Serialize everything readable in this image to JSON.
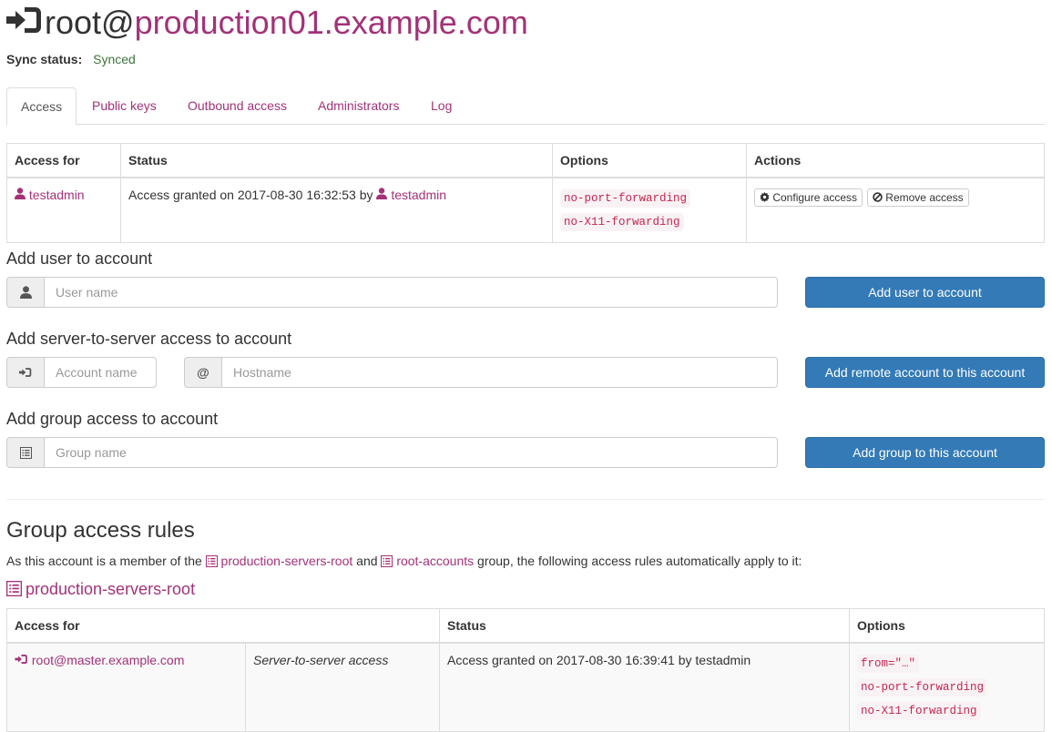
{
  "header": {
    "user": "root",
    "at": "@",
    "hostname": "production01.example.com",
    "sync_label": "Sync status:",
    "sync_value": "Synced",
    "sync_color": "#3c763d"
  },
  "tabs": [
    {
      "label": "Access",
      "active": true
    },
    {
      "label": "Public keys",
      "active": false
    },
    {
      "label": "Outbound access",
      "active": false
    },
    {
      "label": "Administrators",
      "active": false
    },
    {
      "label": "Log",
      "active": false
    }
  ],
  "access_table": {
    "headers": [
      "Access for",
      "Status",
      "Options",
      "Actions"
    ],
    "rows": [
      {
        "access_for": "testadmin",
        "status_prefix": "Access granted on 2017-08-30 16:32:53 by",
        "status_user": "testadmin",
        "options": [
          "no-port-forwarding",
          "no-X11-forwarding"
        ],
        "actions": [
          "Configure access",
          "Remove access"
        ]
      }
    ]
  },
  "add_user": {
    "heading": "Add user to account",
    "placeholder": "User name",
    "button": "Add user to account"
  },
  "add_server": {
    "heading": "Add server-to-server access to account",
    "account_placeholder": "Account name",
    "at_symbol": "@",
    "host_placeholder": "Hostname",
    "button": "Add remote account to this account"
  },
  "add_group": {
    "heading": "Add group access to account",
    "placeholder": "Group name",
    "button": "Add group to this account"
  },
  "group_rules": {
    "heading": "Group access rules",
    "intro_prefix": "As this account is a member of the",
    "group1": "production-servers-root",
    "intro_and": "and",
    "group2": "root-accounts",
    "intro_suffix": "group, the following access rules automatically apply to it:",
    "group_title": "production-servers-root",
    "headers": [
      "Access for",
      "Status",
      "Options"
    ],
    "rows": [
      {
        "access_for": "root@master.example.com",
        "type": "Server-to-server access",
        "status": "Access granted on 2017-08-30 16:39:41 by testadmin",
        "options": [
          "from=\"…\"",
          "no-port-forwarding",
          "no-X11-forwarding"
        ]
      }
    ]
  },
  "colors": {
    "link": "#a33278",
    "primary": "#337ab7",
    "code": "#c7254e"
  }
}
